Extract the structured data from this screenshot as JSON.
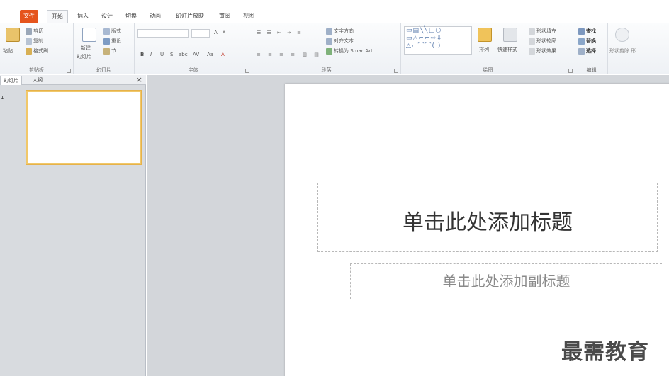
{
  "ribbon_tabs": [
    {
      "label": "文件"
    },
    {
      "label": "开始"
    },
    {
      "label": "插入"
    },
    {
      "label": "设计"
    },
    {
      "label": "切换"
    },
    {
      "label": "动画"
    },
    {
      "label": "幻灯片放映"
    },
    {
      "label": "审阅"
    },
    {
      "label": "视图"
    }
  ],
  "clipboard": {
    "paste": "粘贴",
    "cut": "剪切",
    "copy": "复制",
    "format_painter": "格式刷",
    "label": "剪贴板"
  },
  "slides_group": {
    "new_slide": "新建",
    "new_slide2": "幻灯片",
    "layout": "版式",
    "reset": "重设",
    "section": "节",
    "label": "幻灯片"
  },
  "font_group": {
    "bold": "B",
    "italic": "I",
    "underline": "U",
    "shadow": "S",
    "strike": "abc",
    "spacing": "AV",
    "case": "Aa",
    "color": "A",
    "grow": "A",
    "shrink": "A",
    "label": "字体"
  },
  "paragraph_group": {
    "text_direction": "文字方向",
    "align_text": "对齐文本",
    "smartart": "转换为 SmartArt",
    "label": "段落"
  },
  "drawing_group": {
    "arrange": "排列",
    "quick_styles": "快速样式",
    "shape_fill": "形状填充",
    "shape_outline": "形状轮廓",
    "shape_effects": "形状效果",
    "label": "绘图"
  },
  "editing_group": {
    "find": "查找",
    "replace": "替换",
    "select": "选择",
    "label": "编辑"
  },
  "extra_group": {
    "label": "形状剪除 形"
  },
  "pane": {
    "tab_slides": "幻灯片",
    "tab_outline": "大纲",
    "close": "×",
    "slide_number": "1"
  },
  "slide": {
    "title_placeholder": "单击此处添加标题",
    "subtitle_placeholder": "单击此处添加副标题"
  },
  "watermark": "最需教育",
  "colors": {
    "file_tab": "#e5541c",
    "thumb_border": "#f1c86a",
    "canvas_bg": "#d3d6da"
  }
}
